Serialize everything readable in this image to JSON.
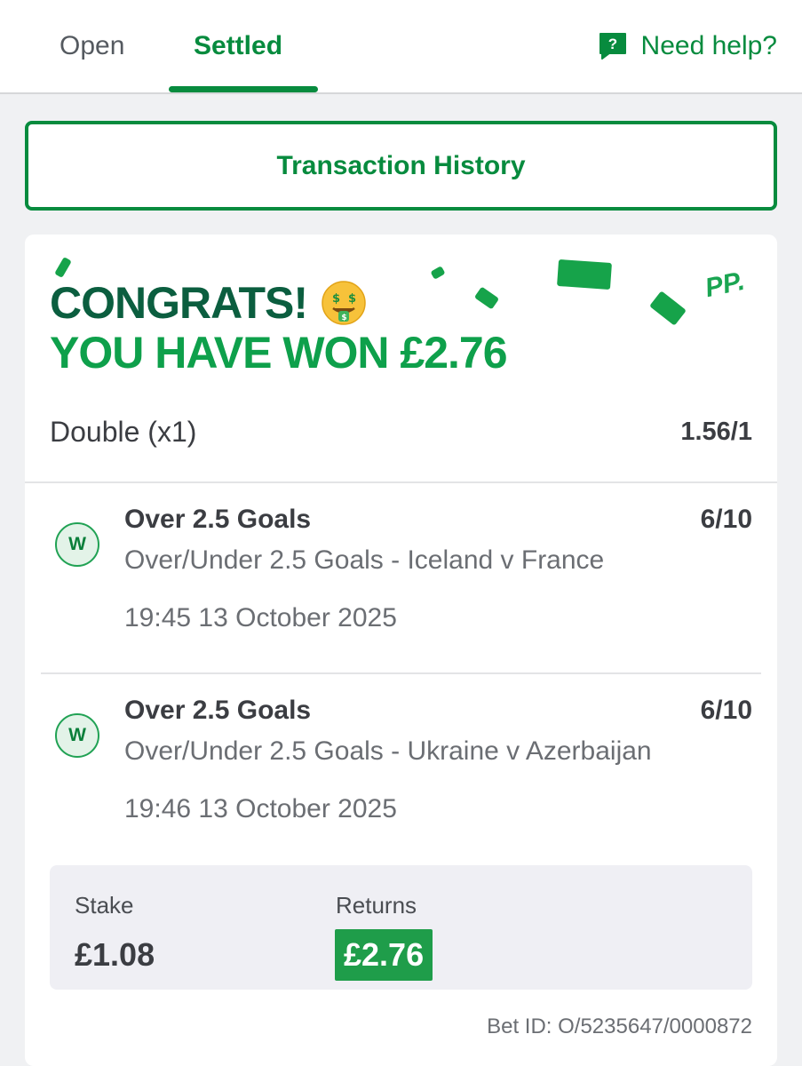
{
  "tabs": {
    "open_label": "Open",
    "settled_label": "Settled",
    "active": "Settled"
  },
  "help": {
    "label": "Need help?"
  },
  "transaction_history": {
    "label": "Transaction History"
  },
  "banner": {
    "congrats": "CONGRATS!",
    "won": "YOU HAVE WON £2.76",
    "brand": "PP."
  },
  "bet": {
    "type_label": "Double (x1)",
    "odds": "1.56/1",
    "legs": [
      {
        "status": "W",
        "selection": "Over 2.5 Goals",
        "odds": "6/10",
        "market": "Over/Under 2.5 Goals - Iceland v France",
        "time": "19:45 13 October 2025"
      },
      {
        "status": "W",
        "selection": "Over 2.5 Goals",
        "odds": "6/10",
        "market": "Over/Under 2.5 Goals - Ukraine v Azerbaijan",
        "time": "19:46 13 October 2025"
      }
    ],
    "stake_label": "Stake",
    "stake": "£1.08",
    "returns_label": "Returns",
    "returns": "£2.76",
    "bet_id": "Bet ID: O/5235647/0000872"
  },
  "colors": {
    "brand_green": "#078b3e",
    "dark_green": "#0b5e3f",
    "bright_green": "#0ea04b",
    "returns_bg": "#1f9d4a"
  }
}
